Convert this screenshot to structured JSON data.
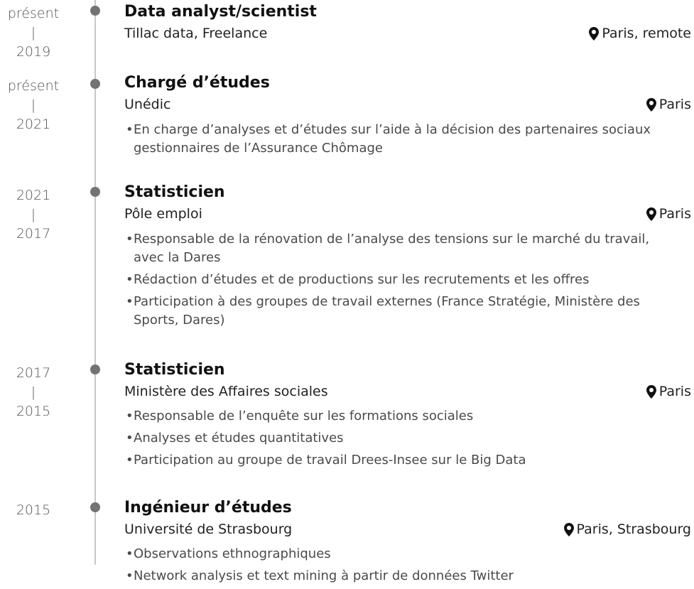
{
  "entries": [
    {
      "dates": [
        "présent",
        "|",
        "2019"
      ],
      "title": "Data analyst/scientist",
      "organization": "Tillac data, Freelance",
      "location": "Paris, remote",
      "bullets": []
    },
    {
      "dates": [
        "présent",
        "|",
        "2021"
      ],
      "title": "Chargé d’études",
      "organization": "Unédic",
      "location": "Paris",
      "bullets": [
        "En charge d’analyses et d’études sur l’aide à la décision des partenaires sociaux gestionnaires de l’Assurance Chômage"
      ]
    },
    {
      "dates": [
        "2021",
        "|",
        "2017"
      ],
      "title": "Statisticien",
      "organization": "Pôle emploi",
      "location": "Paris",
      "bullets": [
        "Responsable de la rénovation de l’analyse des tensions sur le marché du travail, avec la Dares",
        "Rédaction d’études et de productions sur les recrutements et les offres",
        "Participation à des groupes de travail externes (France Stratégie, Ministère des Sports, Dares)"
      ]
    },
    {
      "dates": [
        "2017",
        "|",
        "2015"
      ],
      "title": "Statisticien",
      "organization": "Ministère des Affaires sociales",
      "location": "Paris",
      "bullets": [
        "Responsable de l’enquête sur les formations sociales",
        "Analyses et études quantitatives",
        "Participation au groupe de travail Drees-Insee sur le Big Data"
      ]
    },
    {
      "dates": [
        "2015"
      ],
      "title": "Ingénieur d’études",
      "organization": "Université de Strasbourg",
      "location": "Paris, Strasbourg",
      "bullets": [
        "Observations ethnographiques",
        "Network analysis et text mining à partir de données Twitter"
      ]
    }
  ],
  "bullet_symbol": "•",
  "icons": {
    "location": "map-marker-icon"
  },
  "colors": {
    "timeline_line": "#c8c8c8",
    "timeline_dot": "#737373",
    "title": "#111111",
    "text": "#4a4a4a"
  }
}
